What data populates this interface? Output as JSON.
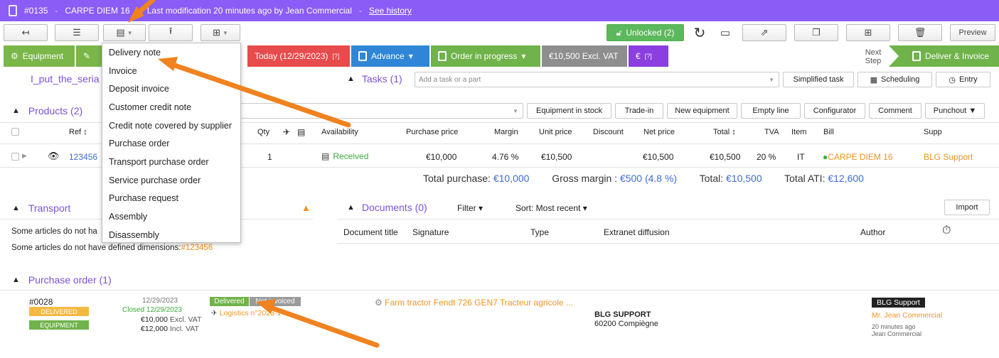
{
  "title_bar": {
    "number": "#0135",
    "name": "CARPE DIEM 16",
    "modification": "Last modification 20 minutes ago by Jean Commercial",
    "history_link": "See history",
    "separator": "-"
  },
  "toolbar": {
    "unlocked_label": "Unlocked (2)",
    "preview_label": "Preview"
  },
  "workflow": {
    "equipment": "Equipment",
    "today": "Today (12/29/2023)",
    "today_help": "[?]",
    "advance": "Advance",
    "order_progress": "Order in progress",
    "excl_vat": "€10,500 Excl. VAT",
    "euro_help": "[?]",
    "next_step_line1": "Next",
    "next_step_line2": "Step",
    "deliver_invoice": "Deliver & Invoice"
  },
  "serial_text": "I_put_the_seria",
  "tasks": {
    "title": "Tasks (1)",
    "placeholder": "Add a task or a part",
    "simplified": "Simplified task",
    "scheduling": "Scheduling",
    "entry": "Entry"
  },
  "products": {
    "title": "Products (2)",
    "buttons": [
      "Equipment in stock",
      "Trade-in",
      "New equipment",
      "Empty line",
      "Configurator",
      "Comment",
      "Punchout ▼"
    ],
    "columns": {
      "ref": "Ref ↕",
      "qty": "Qty",
      "availability": "Availability",
      "purchase_price": "Purchase price",
      "margin": "Margin",
      "unit_price": "Unit price",
      "discount": "Discount",
      "net_price": "Net price",
      "total": "Total ↕",
      "tva": "TVA",
      "item": "Item",
      "bill": "Bill",
      "supp": "Supp"
    },
    "row": {
      "ref": "123456",
      "qty": "1",
      "availability": "Received",
      "purchase_price": "€10,000",
      "margin": "4.76 %",
      "unit_price": "€10,500",
      "net_price": "€10,500",
      "total": "€10,500",
      "tva": "20 %",
      "item": "IT",
      "bill": "CARPE DIEM 16",
      "supp": "BLG Support"
    },
    "totals": {
      "purchase_label": "Total purchase:",
      "purchase_value": "€10,000",
      "margin_label": "Gross margin :",
      "margin_value": "€500 (4.8 %)",
      "total_label": "Total:",
      "total_value": "€10,500",
      "ati_label": "Total ATI:",
      "ati_value": "€12,600"
    }
  },
  "transport": {
    "title": "Transport",
    "line1": "Some articles do not ha",
    "line2_prefix": "Some articles do not have defined dimensions:",
    "line2_link": "#123456"
  },
  "documents": {
    "title": "Documents (0)",
    "filter": "Filter ▾",
    "sort": "Sort: Most recent ▾",
    "import": "Import",
    "columns": {
      "doc_title": "Document title",
      "signature": "Signature",
      "type": "Type",
      "extranet": "Extranet diffusion",
      "author": "Author"
    }
  },
  "purchase_order": {
    "title": "Purchase order (1)",
    "number": "#0028",
    "badge_delivered": "DELIVERED",
    "badge_equipment": "EQUIPMENT",
    "date": "12/29/2023",
    "closed": "Closed 12/29/2023",
    "excl_amount": "€10,000",
    "excl_label": "Excl. VAT",
    "incl_amount": "€12,000",
    "incl_label": "Incl. VAT",
    "status_delivered": "Delivered",
    "status_invoiced": "Not invoiced",
    "logistics": "Logistics n°2023-1",
    "product": "Farm tractor Fendt 726 GEN7 Tracteur agricole ...",
    "supplier_name": "BLG SUPPORT",
    "supplier_city": "60200 Compiègne",
    "supplier_tag": "BLG Support",
    "contact": "Mr. Jean Commercial",
    "time_ago": "20 minutes ago",
    "author": "Jean Commercial"
  },
  "dropdown": {
    "items": [
      "Delivery note",
      "Invoice",
      "Deposit invoice",
      "Customer credit note",
      "Credit note covered by supplier",
      "Purchase order",
      "Transport purchase order",
      "Service purchase order",
      "Purchase request",
      "Assembly",
      "Disassembly"
    ]
  },
  "colors": {
    "title_bar": "#8b5cf6",
    "equipment": "#7ab648",
    "today": "#e84b4b",
    "advance": "#2f86d6",
    "order_progress": "#6fb34a",
    "excl_vat": "#8e8e8e",
    "euro": "#8b3fe0",
    "deliver": "#6fb34a",
    "arrow": "#f0821f"
  }
}
